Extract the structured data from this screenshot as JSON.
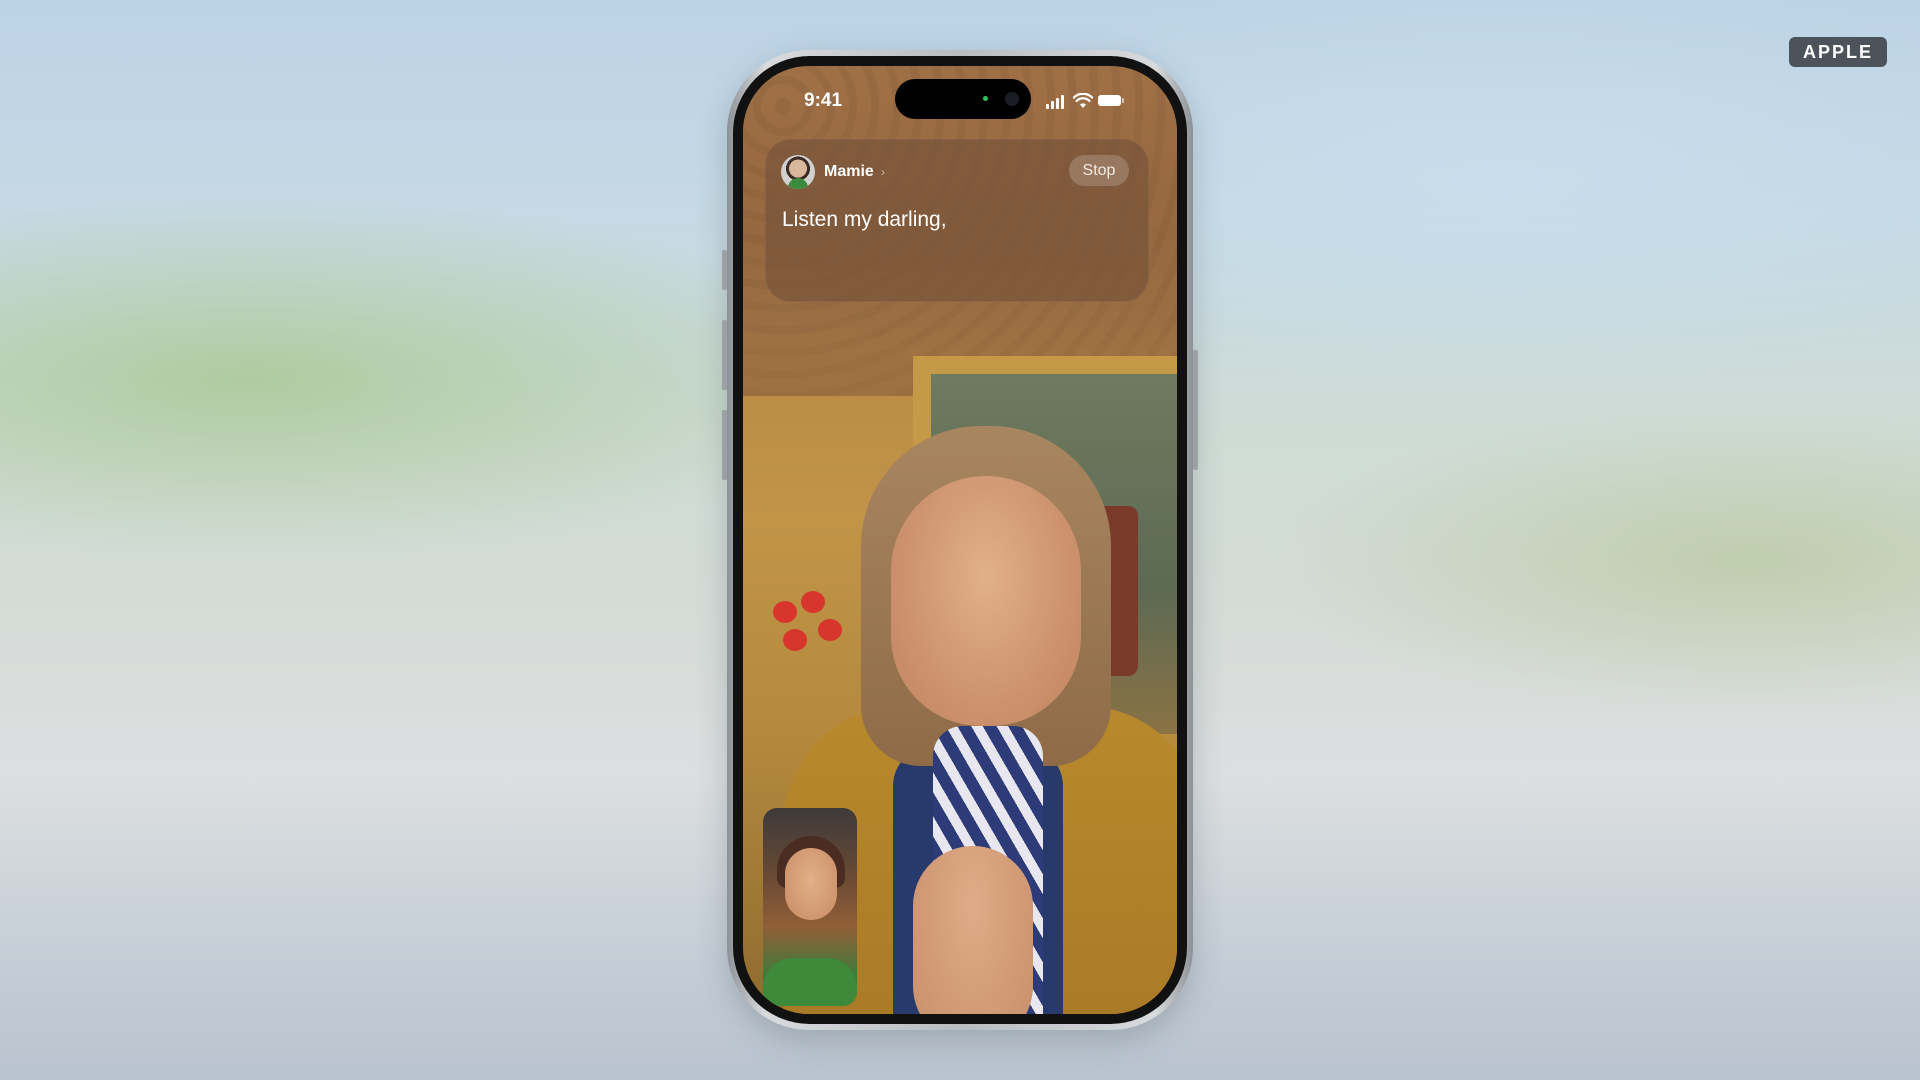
{
  "watermark": {
    "label": "APPLE"
  },
  "status_bar": {
    "time": "9:41",
    "icons": [
      "cellular-signal-icon",
      "wifi-icon",
      "battery-icon"
    ]
  },
  "live_caption": {
    "caller_name": "Mamie",
    "chevron": "›",
    "stop_label": "Stop",
    "caption_text": "Listen my darling,"
  },
  "colors": {
    "badge_bg": "#4c535b",
    "caption_panel_bg": "rgba(120,84,58,0.72)",
    "dynamic_island_indicator": "#2fc25b"
  }
}
